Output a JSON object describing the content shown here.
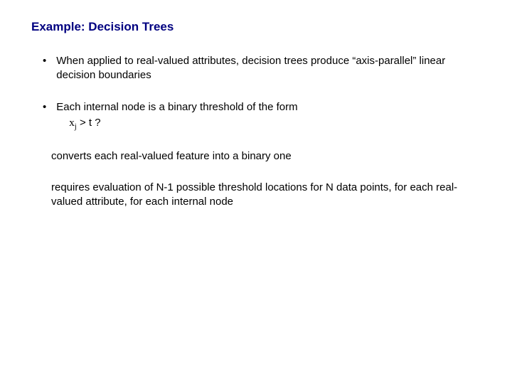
{
  "title": "Example: Decision Trees",
  "bullets": [
    {
      "text": "When applied to real-valued attributes, decision trees produce “axis-parallel” linear decision boundaries"
    },
    {
      "text": "Each internal node is a binary threshold of the form",
      "formula_var": "x",
      "formula_sub": "j",
      "formula_rest": " > t ?"
    }
  ],
  "paragraphs": [
    "converts each real-valued feature into a binary one",
    "requires evaluation of N-1 possible threshold locations for N data points, for each real-valued attribute, for each internal node"
  ]
}
